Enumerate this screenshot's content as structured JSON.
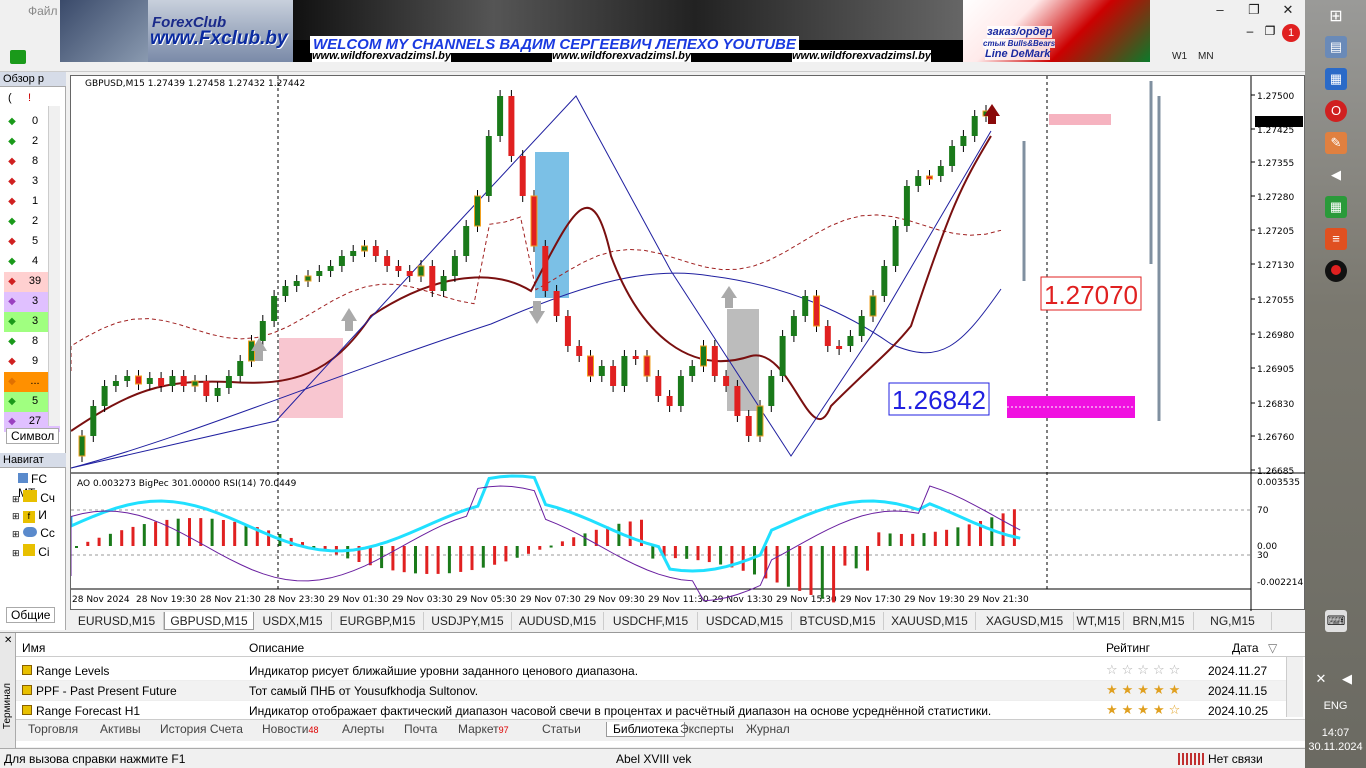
{
  "menu": {
    "file": "Файл"
  },
  "window_buttons": {
    "minimize": "–",
    "restore": "❐",
    "close": "✕",
    "inner_minimize": "–",
    "inner_restore": "❐"
  },
  "timeframes": [
    "W1",
    "MN"
  ],
  "notification_count": "1",
  "banner": {
    "site": "www.Fxclub.by",
    "forexclub": "ForexClub",
    "welcome": "WELCOM MY CHANNELS ВАДИМ СЕРГЕЕВИЧ ЛЕПЕХО YOUTUBE",
    "sub1": "www.wildforexvadzimsl.by",
    "sub2": "www.wildforexvadzimsl.by",
    "sub3": "www.wildforexvadzimsl.by",
    "order1": "заказ/ордер",
    "order2": "стык Bulls&Bears",
    "order3": "Line DeMark"
  },
  "market_watch": {
    "title": "Обзор р",
    "header_icons": [
      "(",
      "!"
    ],
    "values": [
      "0",
      "2",
      "8",
      "3",
      "1",
      "2",
      "5",
      "4",
      "39",
      "3",
      "3",
      "8",
      "9",
      "...",
      "5",
      "27"
    ],
    "row_colors": [
      "#1a9a1a",
      "#1a9a1a",
      "#d02020",
      "#d02020",
      "#d02020",
      "#1a9a1a",
      "#d02020",
      "#1a9a1a",
      "#d02020",
      "#9a40c0",
      "#1a9a1a",
      "#1a9a1a",
      "#d02020",
      "#e07000",
      "#1a9a1a",
      "#9a40c0"
    ],
    "row_bg": [
      "",
      "",
      "",
      "",
      "",
      "",
      "",
      "",
      "#ffd0d0",
      "#e0c0ff",
      "#a0ff80",
      "",
      "",
      "#ff9000",
      "#a0ff80",
      "#e0c0ff"
    ],
    "tab_symbols": "Символ"
  },
  "navigator": {
    "title": "Навигат",
    "items": [
      "FC MT",
      "Сч",
      "И",
      "Сс",
      "Сі"
    ],
    "tab_common": "Общие"
  },
  "chart": {
    "header": "GBPUSD,M15  1.27439 1.27458 1.27432 1.27442",
    "indicator_header": "AO 0.003273  BigPec 301.00000  RSI(14) 70.0449",
    "current_price": "1.27442",
    "level_red": "1.27070",
    "level_blue": "1.26842",
    "price_ticks": [
      "1.27500",
      "1.27425",
      "1.27355",
      "1.27280",
      "1.27205",
      "1.27130",
      "1.27055",
      "1.26980",
      "1.26905",
      "1.26830",
      "1.26760",
      "1.26685"
    ],
    "sub_ticks": [
      "0.003535",
      "70",
      "0.00",
      "30",
      "-0.002214"
    ],
    "time_ticks": [
      "28 Nov 2024",
      "28 Nov 19:30",
      "28 Nov 21:30",
      "28 Nov 23:30",
      "29 Nov 01:30",
      "29 Nov 03:30",
      "29 Nov 05:30",
      "29 Nov 07:30",
      "29 Nov 09:30",
      "29 Nov 11:30",
      "29 Nov 13:30",
      "29 Nov 15:30",
      "29 Nov 17:30",
      "29 Nov 19:30",
      "29 Nov 21:30"
    ]
  },
  "symbol_tabs": [
    "EURUSD,M15",
    "GBPUSD,M15",
    "USDX,M15",
    "EURGBP,M15",
    "USDJPY,M15",
    "AUDUSD,M15",
    "USDCHF,M15",
    "USDCAD,M15",
    "BTCUSD,M15",
    "XAUUSD,M15",
    "XAGUSD,M15",
    "WT,M15",
    "BRN,M15",
    "NG,M15"
  ],
  "active_symbol": "GBPUSD,M15",
  "terminal": {
    "side_label": "Терминал",
    "columns": {
      "name": "Имя",
      "description": "Описание",
      "rating": "Рейтинг",
      "date": "Дата"
    },
    "rows": [
      {
        "name": "Range Levels",
        "description": "Индикатор рисует ближайшие уровни заданного ценового диапазона.",
        "rating": "☆☆☆☆☆",
        "date": "2024.11.27"
      },
      {
        "name": "PPF - Past Present Future",
        "description": "Тот самый ПНБ от Yousufkhodja Sultonov.",
        "rating": "★★★★★",
        "date": "2024.11.15"
      },
      {
        "name": "Range Forecast H1",
        "description": "Индикатор отображает фактический диапазон часовой свечи в процентах и расчётный диапазон на основе усреднённой статистики.",
        "rating": "★★★★☆",
        "date": "2024.10.25"
      }
    ],
    "tabs": [
      {
        "label": "Торговля"
      },
      {
        "label": "Активы"
      },
      {
        "label": "История Счета"
      },
      {
        "label": "Новости",
        "badge": "48"
      },
      {
        "label": "Алерты"
      },
      {
        "label": "Почта"
      },
      {
        "label": "Маркет",
        "badge": "97"
      },
      {
        "label": "Статьи"
      },
      {
        "label": "Библиотека"
      },
      {
        "label": "Эксперты"
      },
      {
        "label": "Журнал"
      }
    ],
    "active_tab": "Библиотека"
  },
  "status": {
    "help": "Для вызова справки нажмите F1",
    "profile": "Abel XVIII vek",
    "connection": "Нет связи"
  },
  "taskbar": {
    "lang": "ENG",
    "time": "14:07",
    "date": "30.11.2024"
  }
}
